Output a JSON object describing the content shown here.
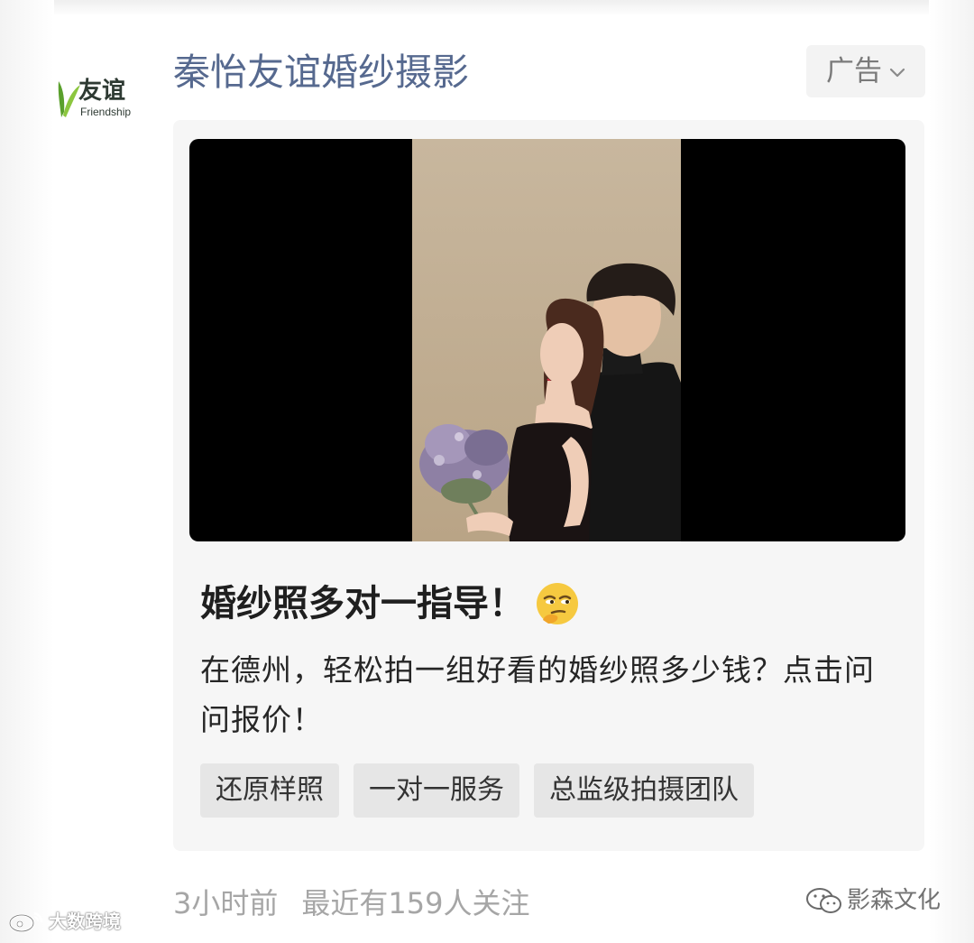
{
  "advertiser": {
    "logo_text": "友谊",
    "logo_subtext": "Friendship",
    "name": "秦怡友谊婚纱摄影"
  },
  "ad_tag": {
    "label": "广告",
    "icon": "chevron-down-icon"
  },
  "ad": {
    "title": "婚纱照多对一指导！",
    "title_emoji": "smirking-face-emoji",
    "description": "在德州，轻松拍一组好看的婚纱照多少钱？点击问问报价！",
    "tags": [
      "还原样照",
      "一对一服务",
      "总监级拍摄团队"
    ]
  },
  "footer": {
    "time": "3小时前",
    "followers": "最近有159人关注"
  },
  "watermarks": {
    "right": "影森文化",
    "left": "大数跨境"
  },
  "colors": {
    "advertiser_name": "#56698f",
    "card_background": "#f6f6f6",
    "tag_background": "#e6e6e6",
    "footer_text": "#a6a6a6",
    "logo_green": "#5aa02c"
  }
}
